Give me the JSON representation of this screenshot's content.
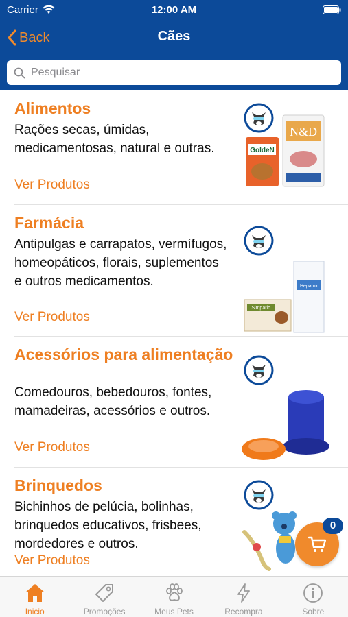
{
  "status_bar": {
    "carrier": "Carrier",
    "time": "12:00 AM"
  },
  "nav": {
    "back_label": "Back",
    "title": "Cães"
  },
  "search": {
    "placeholder": "Pesquisar",
    "value": ""
  },
  "categories": [
    {
      "title": "Alimentos",
      "description": "Rações secas, úmidas, medicamentosas, natural e outras.",
      "link": "Ver Produtos",
      "image_icon": "dog-food-packages-icon"
    },
    {
      "title": "Farmácia",
      "description": "Antipulgas e carrapatos, vermífugos, homeopáticos, florais, suplementos e outros medicamentos.",
      "link": "Ver Produtos",
      "image_icon": "medicine-boxes-icon"
    },
    {
      "title": "Acessórios para alimentação",
      "description": "Comedouros, bebedouros, fontes, mamadeiras, acessórios e outros.",
      "link": "Ver Produtos",
      "image_icon": "bowl-and-water-dispenser-icon"
    },
    {
      "title": "Brinquedos",
      "description": "Bichinhos de pelúcia, bolinhas, brinquedos educativos, frisbees, mordedores e outros.",
      "link": "Ver Produtos",
      "image_icon": "plush-toy-and-rope-icon"
    }
  ],
  "cart": {
    "count": "0"
  },
  "tabs": [
    {
      "label": "Inicio",
      "icon": "home-icon",
      "active": true
    },
    {
      "label": "Promoções",
      "icon": "tag-icon",
      "active": false
    },
    {
      "label": "Meus Pets",
      "icon": "paw-icon",
      "active": false
    },
    {
      "label": "Recompra",
      "icon": "lightning-icon",
      "active": false
    },
    {
      "label": "Sobre",
      "icon": "info-icon",
      "active": false
    }
  ],
  "colors": {
    "brand_blue": "#0c4a99",
    "accent_orange": "#ee7f22"
  }
}
